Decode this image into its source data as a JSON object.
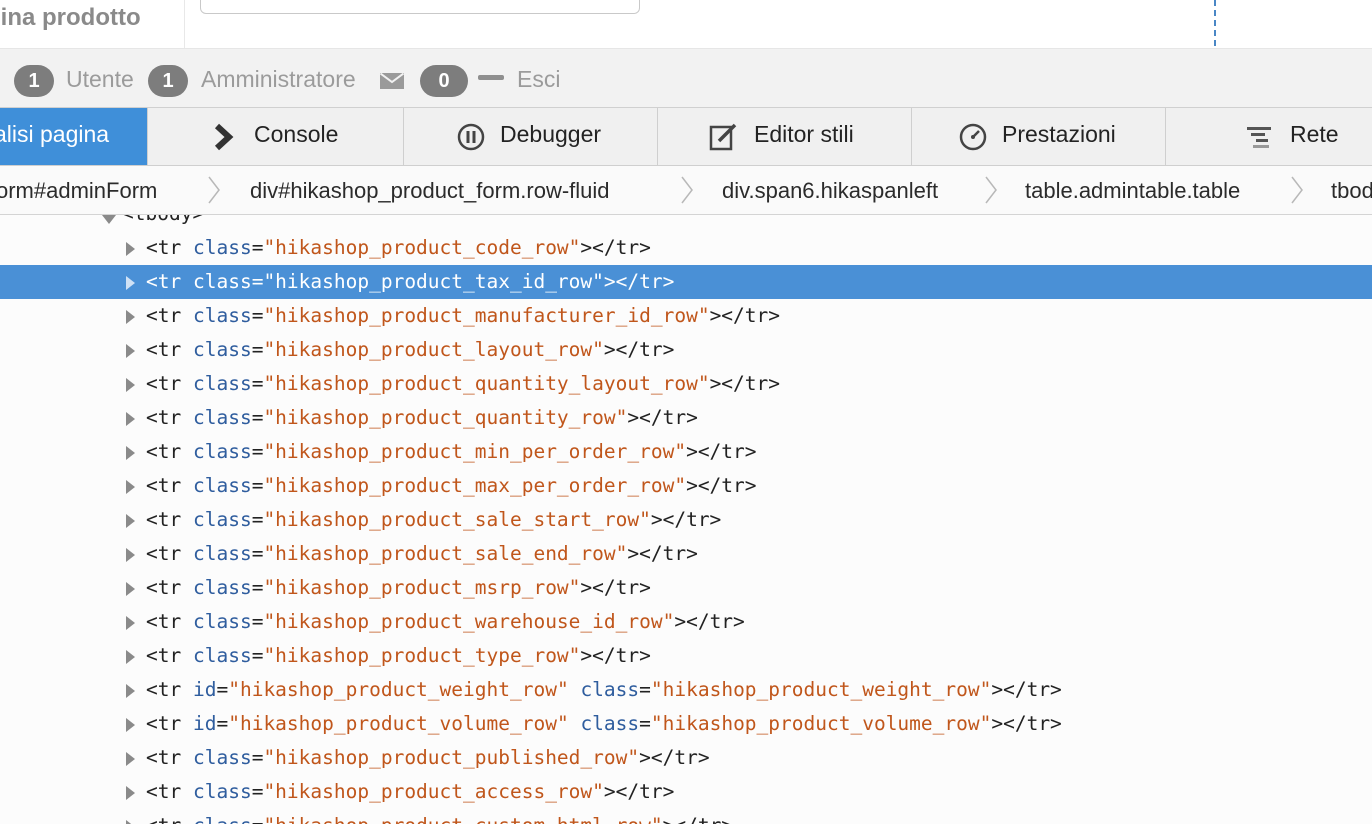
{
  "page": {
    "title": "gina prodotto"
  },
  "statusbar": {
    "users_count": "1",
    "users_label": "Utente",
    "admins_count": "1",
    "admins_label": "Amministratore",
    "messages_count": "0",
    "logout_label": "Esci"
  },
  "toolbar": {
    "tabs": [
      {
        "label": "alisi pagina",
        "icon": "inspector-icon",
        "active": true
      },
      {
        "label": "Console",
        "icon": "console-icon"
      },
      {
        "label": "Debugger",
        "icon": "pause-icon"
      },
      {
        "label": "Editor stili",
        "icon": "pencil-edit-icon"
      },
      {
        "label": "Prestazioni",
        "icon": "gauge-icon"
      },
      {
        "label": "Rete",
        "icon": "network-icon"
      }
    ],
    "active_color": "#3f8fd9"
  },
  "breadcrumbs": [
    "orm#adminForm",
    "div#hikashop_product_form.row-fluid",
    "div.span6.hikaspanleft",
    "table.admintable.table",
    "tbod"
  ],
  "tree": {
    "parent_tag": "<tbody>",
    "rows": [
      {
        "attrs": [
          {
            "name": "class",
            "value": "hikashop_product_code_row"
          }
        ]
      },
      {
        "attrs": [
          {
            "name": "class",
            "value": "hikashop_product_tax_id_row"
          }
        ],
        "selected": true
      },
      {
        "attrs": [
          {
            "name": "class",
            "value": "hikashop_product_manufacturer_id_row"
          }
        ]
      },
      {
        "attrs": [
          {
            "name": "class",
            "value": "hikashop_product_layout_row"
          }
        ]
      },
      {
        "attrs": [
          {
            "name": "class",
            "value": "hikashop_product_quantity_layout_row"
          }
        ]
      },
      {
        "attrs": [
          {
            "name": "class",
            "value": "hikashop_product_quantity_row"
          }
        ]
      },
      {
        "attrs": [
          {
            "name": "class",
            "value": "hikashop_product_min_per_order_row"
          }
        ]
      },
      {
        "attrs": [
          {
            "name": "class",
            "value": "hikashop_product_max_per_order_row"
          }
        ]
      },
      {
        "attrs": [
          {
            "name": "class",
            "value": "hikashop_product_sale_start_row"
          }
        ]
      },
      {
        "attrs": [
          {
            "name": "class",
            "value": "hikashop_product_sale_end_row"
          }
        ]
      },
      {
        "attrs": [
          {
            "name": "class",
            "value": "hikashop_product_msrp_row"
          }
        ]
      },
      {
        "attrs": [
          {
            "name": "class",
            "value": "hikashop_product_warehouse_id_row"
          }
        ]
      },
      {
        "attrs": [
          {
            "name": "class",
            "value": "hikashop_product_type_row"
          }
        ]
      },
      {
        "attrs": [
          {
            "name": "id",
            "value": "hikashop_product_weight_row"
          },
          {
            "name": "class",
            "value": "hikashop_product_weight_row"
          }
        ]
      },
      {
        "attrs": [
          {
            "name": "id",
            "value": "hikashop_product_volume_row"
          },
          {
            "name": "class",
            "value": "hikashop_product_volume_row"
          }
        ]
      },
      {
        "attrs": [
          {
            "name": "class",
            "value": "hikashop_product_published_row"
          }
        ]
      },
      {
        "attrs": [
          {
            "name": "class",
            "value": "hikashop_product_access_row"
          }
        ]
      },
      {
        "attrs": [
          {
            "name": "class",
            "value": "hikashop_product_custom_html_row"
          }
        ]
      }
    ],
    "colors": {
      "tag": "#222222",
      "attr": "#2f5d9e",
      "value": "#c0561b",
      "selected_bg": "#4a90d6"
    }
  }
}
